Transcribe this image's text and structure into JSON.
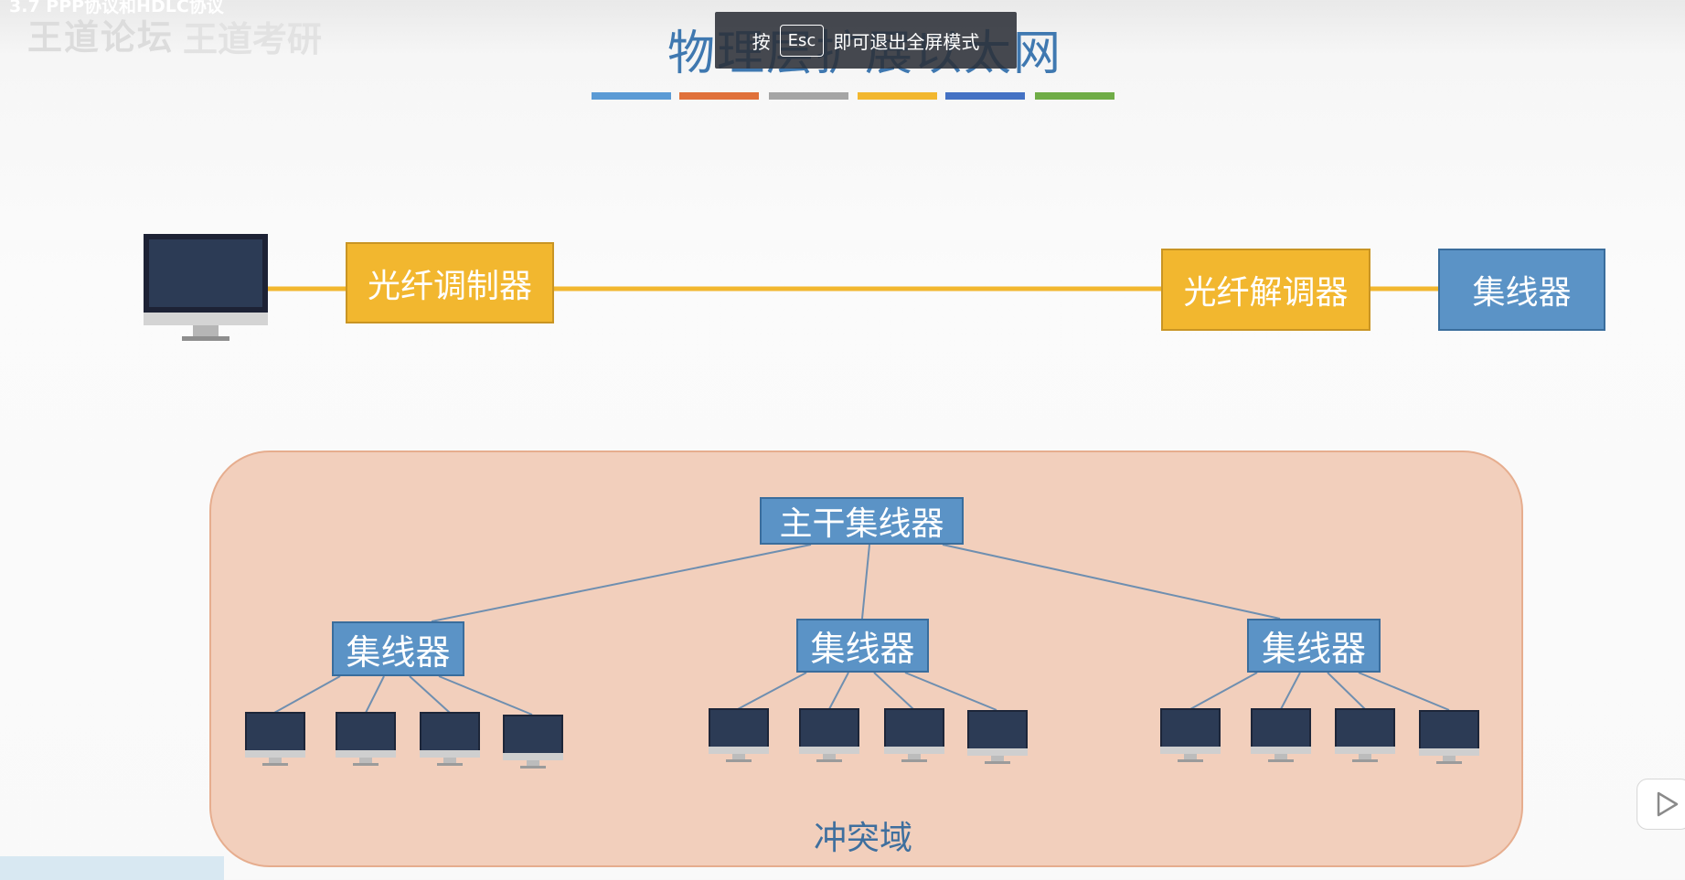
{
  "watermark": {
    "chapter": "3.7 PPP协议和HDLC协议",
    "forum": "王道论坛",
    "brand": "王道考研"
  },
  "slide": {
    "title": "物理层扩展以太网",
    "color_bars": [
      "#5b9bd5",
      "#e0713a",
      "#a5a5a5",
      "#f2b72f",
      "#4472c4",
      "#70ad47"
    ]
  },
  "fullscreen_hint": {
    "prefix": "按",
    "key": "Esc",
    "suffix": "即可退出全屏模式"
  },
  "top_chain": {
    "modulator": "光纤调制器",
    "demodulator": "光纤解调器",
    "hub": "集线器"
  },
  "tree": {
    "backbone_hub": "主干集线器",
    "hubs": [
      "集线器",
      "集线器",
      "集线器"
    ],
    "domain_label": "冲突域"
  },
  "icons": {
    "monitor": "monitor-icon",
    "play": "play-icon"
  }
}
